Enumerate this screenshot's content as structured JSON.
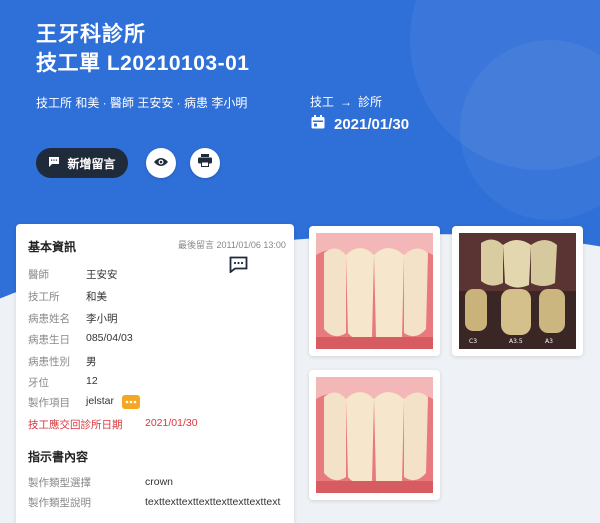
{
  "header": {
    "clinic_name": "王牙科診所",
    "order_title": "技工單 L20210103-01",
    "meta": "技工所 和美 · 醫師 王安安 · 病患 李小明",
    "flow_from": "技工",
    "flow_arrow": "→",
    "flow_to": "診所",
    "date": "2021/01/30"
  },
  "actions": {
    "add_message": "新增留言"
  },
  "basic_info": {
    "title": "基本資訊",
    "last_message": "最後留言 2011/01/06 13:00",
    "rows": [
      {
        "k": "醫師",
        "v": "王安安"
      },
      {
        "k": "技工所",
        "v": "和美"
      },
      {
        "k": "病患姓名",
        "v": "李小明"
      },
      {
        "k": "病患生日",
        "v": "085/04/03"
      },
      {
        "k": "病患性別",
        "v": "男"
      },
      {
        "k": "牙位",
        "v": "12"
      },
      {
        "k": "製作項目",
        "v": "jelstar"
      }
    ],
    "due_label": "技工應交回診所日期",
    "due_value": "2021/01/30"
  },
  "instructions": {
    "title": "指示書內容",
    "type_label": "製作類型選擇",
    "type_value": "crown",
    "desc_label": "製作類型說明",
    "desc_value": "texttexttexttexttexttexttexttext"
  },
  "photos": {
    "shade_labels": [
      "C3",
      "A3.5",
      "A3"
    ]
  },
  "colors": {
    "brand": "#2f6fd8",
    "dark_button": "#1f2a3a",
    "accent_orange": "#f5a623",
    "due_red": "#d9363e"
  }
}
